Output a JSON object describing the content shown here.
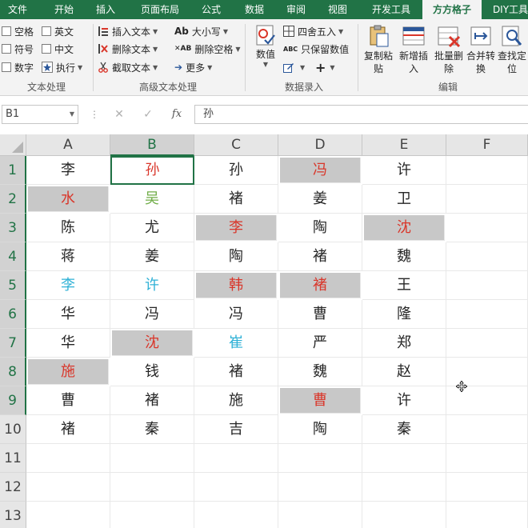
{
  "tabs": [
    {
      "label": "文件"
    },
    {
      "label": "开始"
    },
    {
      "label": "插入"
    },
    {
      "label": "页面布局"
    },
    {
      "label": "公式"
    },
    {
      "label": "数据"
    },
    {
      "label": "审阅"
    },
    {
      "label": "视图"
    },
    {
      "label": "开发工具"
    },
    {
      "label": "方方格子"
    },
    {
      "label": "DIY工具"
    }
  ],
  "active_tab": "方方格子",
  "ribbon": {
    "text_processing": {
      "checkboxes": [
        "空格",
        "英文",
        "符号",
        "中文",
        "数字"
      ],
      "execute": "执行",
      "group_label": "文本处理"
    },
    "advanced_text": {
      "insert_text": "插入文本",
      "delete_text": "删除文本",
      "cut_text": "截取文本",
      "case": "大小写",
      "delete_spaces": "删除空格",
      "more": "更多",
      "group_label": "高级文本处理"
    },
    "numeric_entry": {
      "value_label": "数值",
      "round": "四舍五入",
      "keep_values": "只保留数值",
      "group_label": "数据录入"
    },
    "edit": {
      "buttons": [
        "复制粘贴",
        "新增插入",
        "批量删除",
        "合并转换",
        "查找定位"
      ],
      "group_label": "编辑"
    }
  },
  "formula_bar": {
    "name_box": "B1",
    "fx": "fx",
    "content": "孙"
  },
  "grid": {
    "columns": [
      "A",
      "B",
      "C",
      "D",
      "E",
      "F"
    ],
    "selected_column": "B",
    "rows": [
      "1",
      "2",
      "3",
      "4",
      "5",
      "6",
      "7",
      "8",
      "9",
      "10",
      "11",
      "12",
      "13"
    ],
    "selected_rows": [
      "1",
      "2",
      "3",
      "4",
      "5",
      "6",
      "7",
      "8",
      "9"
    ],
    "active_cell": "B1",
    "cells": [
      [
        "李",
        "孙",
        "孙",
        "冯",
        "许"
      ],
      [
        "水",
        "吴",
        "褚",
        "姜",
        "卫"
      ],
      [
        "陈",
        "尤",
        "李",
        "陶",
        "沈"
      ],
      [
        "蒋",
        "姜",
        "陶",
        "褚",
        "魏"
      ],
      [
        "李",
        "许",
        "韩",
        "褚",
        "王"
      ],
      [
        "华",
        "冯",
        "冯",
        "曹",
        "隆"
      ],
      [
        "华",
        "沈",
        "崔",
        "严",
        "郑"
      ],
      [
        "施",
        "钱",
        "褚",
        "魏",
        "赵"
      ],
      [
        "曹",
        "褚",
        "施",
        "曹",
        "许"
      ],
      [
        "褚",
        "秦",
        "吉",
        "陶",
        "秦"
      ]
    ],
    "cell_colors": [
      [
        "#262626",
        "#d9362a",
        "#262626",
        "#d9362a",
        "#262626"
      ],
      [
        "#d9362a",
        "#70ad47",
        "#262626",
        "#262626",
        "#262626"
      ],
      [
        "#262626",
        "#262626",
        "#d9362a",
        "#262626",
        "#d9362a"
      ],
      [
        "#262626",
        "#262626",
        "#262626",
        "#262626",
        "#262626"
      ],
      [
        "#2fb1d6",
        "#2fb1d6",
        "#d9362a",
        "#d9362a",
        "#262626"
      ],
      [
        "#262626",
        "#262626",
        "#262626",
        "#262626",
        "#262626"
      ],
      [
        "#262626",
        "#d9362a",
        "#2fb1d6",
        "#262626",
        "#262626"
      ],
      [
        "#d9362a",
        "#262626",
        "#262626",
        "#262626",
        "#262626"
      ],
      [
        "#262626",
        "#262626",
        "#262626",
        "#d9362a",
        "#262626"
      ],
      [
        "#262626",
        "#262626",
        "#262626",
        "#262626",
        "#262626"
      ]
    ],
    "cell_fills": [
      [
        false,
        false,
        false,
        true,
        false
      ],
      [
        true,
        false,
        false,
        false,
        false
      ],
      [
        false,
        false,
        true,
        false,
        true
      ],
      [
        false,
        false,
        false,
        false,
        false
      ],
      [
        false,
        false,
        true,
        true,
        false
      ],
      [
        false,
        false,
        false,
        false,
        false
      ],
      [
        false,
        true,
        false,
        false,
        false
      ],
      [
        true,
        false,
        false,
        false,
        false
      ],
      [
        false,
        false,
        false,
        true,
        false
      ],
      [
        false,
        false,
        false,
        false,
        false
      ]
    ]
  },
  "colors": {
    "excel_green": "#217346",
    "highlight_fill": "#c8c8c8",
    "red_text": "#d9362a",
    "cyan_text": "#2fb1d6",
    "green_text": "#70ad47"
  }
}
